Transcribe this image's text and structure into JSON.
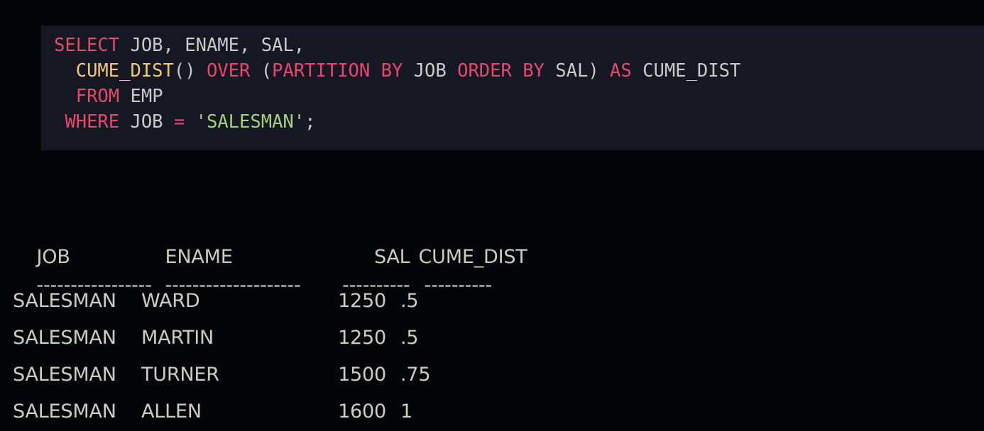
{
  "code_block": {
    "language": "sql",
    "background": "#151822",
    "colors": {
      "keyword": "#e8476d",
      "function": "#f0c87a",
      "string": "#a8d07a",
      "identifier": "#c9c9c9"
    },
    "lines": [
      {
        "indent": "",
        "tokens": [
          {
            "t": "SELECT",
            "k": "kw"
          },
          {
            "t": " JOB, ENAME, SAL,",
            "k": "id"
          }
        ]
      },
      {
        "indent": "  ",
        "tokens": [
          {
            "t": "CUME_DIST",
            "k": "fn"
          },
          {
            "t": "() ",
            "k": "punc"
          },
          {
            "t": "OVER",
            "k": "kw"
          },
          {
            "t": " (",
            "k": "punc"
          },
          {
            "t": "PARTITION BY",
            "k": "kw"
          },
          {
            "t": " JOB ",
            "k": "id"
          },
          {
            "t": "ORDER BY",
            "k": "kw"
          },
          {
            "t": " SAL) ",
            "k": "id"
          },
          {
            "t": "AS",
            "k": "kw"
          },
          {
            "t": " CUME_DIST",
            "k": "id"
          }
        ]
      },
      {
        "indent": "  ",
        "tokens": [
          {
            "t": "FROM",
            "k": "kw"
          },
          {
            "t": " EMP",
            "k": "id"
          }
        ]
      },
      {
        "indent": " ",
        "tokens": [
          {
            "t": "WHERE",
            "k": "kw"
          },
          {
            "t": " JOB ",
            "k": "id"
          },
          {
            "t": "=",
            "k": "kw"
          },
          {
            "t": " ",
            "k": "id"
          },
          {
            "t": "'SALESMAN'",
            "k": "str"
          },
          {
            "t": ";",
            "k": "id"
          }
        ]
      }
    ]
  },
  "result": {
    "text_color": "#cfcbc2",
    "headers": {
      "job": "JOB",
      "ename": "ENAME",
      "sal": "SAL",
      "cume_dist": "CUME_DIST"
    },
    "separators": {
      "job": "-----------------",
      "ename": "--------------------",
      "sal": "----------",
      "cume_dist": "----------"
    },
    "rows": [
      {
        "job": "SALESMAN",
        "ename": "WARD",
        "sal": "1250",
        "cume_dist": ".5"
      },
      {
        "job": "SALESMAN",
        "ename": "MARTIN",
        "sal": "1250",
        "cume_dist": ".5"
      },
      {
        "job": "SALESMAN",
        "ename": "TURNER",
        "sal": "1500",
        "cume_dist": ".75"
      },
      {
        "job": "SALESMAN",
        "ename": "ALLEN",
        "sal": "1600",
        "cume_dist": "1"
      }
    ]
  }
}
